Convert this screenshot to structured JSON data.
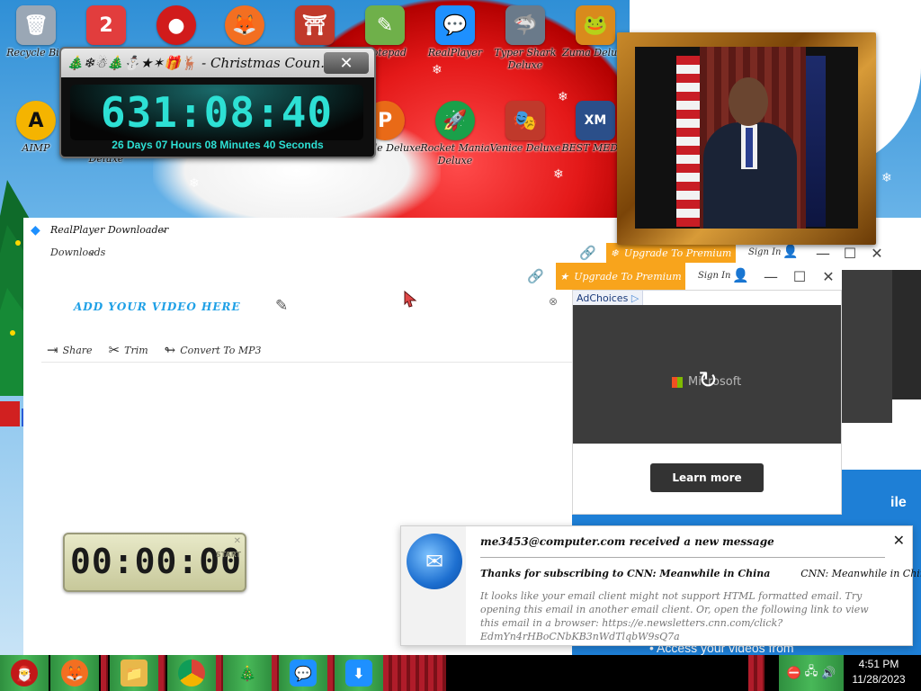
{
  "desktop": {
    "icons": [
      {
        "label": "Recycle Bin",
        "glyph": "trash-icon",
        "color": "#9aa7b5"
      },
      {
        "label": "",
        "glyph": "2",
        "color": "#e23d3d"
      },
      {
        "label": "",
        "glyph": "red-ball",
        "color": "#d11b1b"
      },
      {
        "label": "",
        "glyph": "firefox-icon",
        "color": "#f36f21"
      },
      {
        "label": "",
        "glyph": "torii-icon",
        "color": "#c0392b"
      },
      {
        "label": "Notepad",
        "glyph": "notepad-icon",
        "color": "#6fb04a"
      },
      {
        "label": "RealPlayer",
        "glyph": "chat-bubble",
        "color": "#1e90ff"
      },
      {
        "label": "Typer Shark Deluxe",
        "glyph": "shark-icon",
        "color": "#6a7a8a"
      },
      {
        "label": "Zuma Deluxe",
        "glyph": "zuma-icon",
        "color": "#d98a1c"
      },
      {
        "label": "AIMP",
        "glyph": "A",
        "color": "#f5b400"
      },
      {
        "label": "Deluxe",
        "glyph": "",
        "color": "#3a6ea5"
      },
      {
        "label": "Deluxe",
        "glyph": "",
        "color": "#3a6ea5"
      },
      {
        "label": "Peggle Deluxe",
        "glyph": "P",
        "color": "#e96a17"
      },
      {
        "label": "Rocket Mania Deluxe",
        "glyph": "rocket-icon",
        "color": "#1aa04a"
      },
      {
        "label": "Venice Deluxe",
        "glyph": "venice-icon",
        "color": "#c0392b"
      },
      {
        "label": "BEST MEDIA",
        "glyph": "XM",
        "color": "#2b4f8a"
      }
    ]
  },
  "countdown": {
    "title": "🎄❄☃🎄⛄★✶🎁🦌 - Christmas Coun...",
    "close_label": "✕",
    "big_time": "631:08:40",
    "sub_time": "26 Days 07 Hours 08 Minutes 40 Seconds"
  },
  "app": {
    "title": "RealPlayer Downloader",
    "tab_label": "Downloads",
    "upgrade_label": "Upgrade To Premium",
    "sign_in": "Sign In",
    "headline": "ADD YOUR VIDEO HERE",
    "toolbar": {
      "share": "Share",
      "trim": "Trim",
      "convert": "Convert To MP3"
    }
  },
  "ad": {
    "adchoices": "AdChoices",
    "brand": "Microsoft",
    "learn_more": "Learn more"
  },
  "right_panel": {
    "partial_text": "ile",
    "bullet_text": "Access your videos from"
  },
  "stopwatch": {
    "digits": "00:00:00",
    "start_label": "START",
    "close": "✕"
  },
  "notification": {
    "title": "me3453@computer.com received a new message",
    "subject_left": "Thanks for subscribing to CNN: Meanwhile in China",
    "subject_right": "CNN: Meanwhile in China",
    "body": "It looks like your email client might not support HTML formatted email. Try opening this email in another email client. Or, open the following link to view this email in a browser: https://e.newsletters.cnn.com/click?EdmYn4rHBoCNbKB3nWdTlqbW9sQ7a",
    "close": "✕"
  },
  "taskbar": {
    "time": "4:51 PM",
    "date": "11/28/2023"
  },
  "colors": {
    "accent_orange": "#f8a41c",
    "counter_cyan": "#2de0d4",
    "taskbar_green": "#48b858"
  }
}
